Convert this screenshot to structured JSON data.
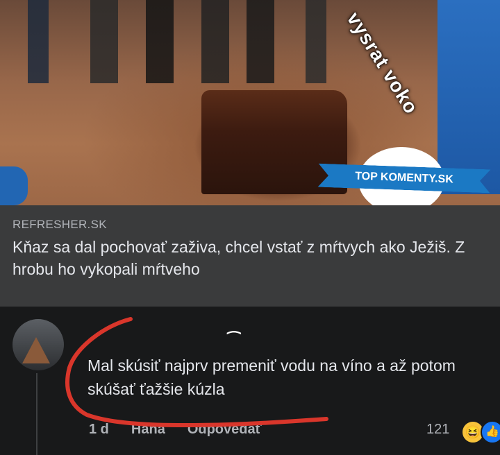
{
  "photo": {
    "watermark": "vysrat voko",
    "badge": "TOP KOMENTY.SK"
  },
  "link_card": {
    "domain": "REFRESHER.SK",
    "title": "Kňaz sa dal pochovať zaživa, chcel vstať z mŕtvych ako Ježiš. Z hrobu ho vykopali mŕtveho"
  },
  "comment": {
    "text": "Mal skúsiť najprv premeniť vodu na víno a až potom skúšať ťažšie kúzla",
    "time": "1 d",
    "reaction_label": "Haha",
    "reply_label": "Odpovedať",
    "reaction_count": "121",
    "reaction_icons": [
      "haha-icon",
      "like-icon"
    ],
    "colors": {
      "annotation_stroke": "#d9362b",
      "like": "#1877f2",
      "haha": "#f7c33b"
    }
  }
}
